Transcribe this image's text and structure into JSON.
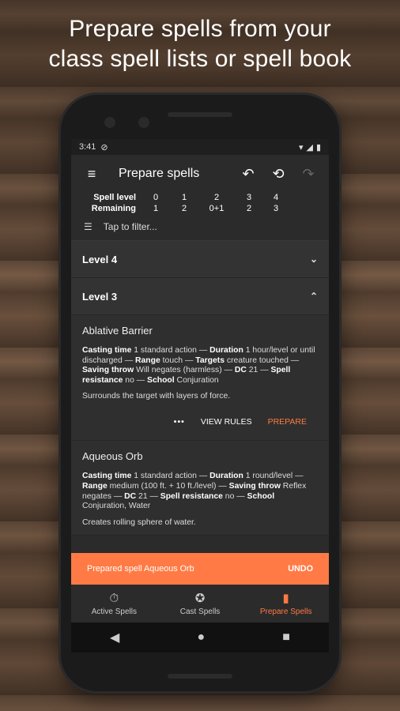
{
  "headline": {
    "line1": "Prepare spells from your",
    "line2": "class spell lists or spell book"
  },
  "status_bar": {
    "time": "3:41"
  },
  "appbar": {
    "title": "Prepare spells"
  },
  "slots": {
    "spell_level_label": "Spell level",
    "remaining_label": "Remaining",
    "levels": [
      "0",
      "1",
      "2",
      "3",
      "4"
    ],
    "remaining": [
      "1",
      "2",
      "0+1",
      "2",
      "3"
    ]
  },
  "filter": {
    "placeholder": "Tap to filter..."
  },
  "levels": {
    "level4": "Level 4",
    "level3": "Level 3"
  },
  "spells": [
    {
      "name": "Ablative Barrier",
      "description": [
        {
          "b": "Casting time",
          "t": " 1 standard action — "
        },
        {
          "b": "Duration",
          "t": " 1 hour/level or until discharged — "
        },
        {
          "b": "Range",
          "t": " touch — "
        },
        {
          "b": "Targets",
          "t": " creature touched — "
        },
        {
          "b": "Saving throw",
          "t": " Will negates (harmless) — "
        },
        {
          "b": "DC",
          "t": " 21 — "
        },
        {
          "b": "Spell resistance",
          "t": " no — "
        },
        {
          "b": "School",
          "t": " Conjuration"
        }
      ],
      "short": "Surrounds the target with layers of force.",
      "more_label": "•••",
      "view_rules_label": "VIEW RULES",
      "prepare_label": "PREPARE"
    },
    {
      "name": "Aqueous Orb",
      "description": [
        {
          "b": "Casting time",
          "t": " 1 standard action — "
        },
        {
          "b": "Duration",
          "t": " 1 round/level — "
        },
        {
          "b": "Range",
          "t": " medium (100 ft. + 10 ft./level) — "
        },
        {
          "b": "Saving throw",
          "t": " Reflex negates — "
        },
        {
          "b": "DC",
          "t": " 21 — "
        },
        {
          "b": "Spell resistance",
          "t": " no — "
        },
        {
          "b": "School",
          "t": " Conjuration, Water"
        }
      ],
      "short": "Creates rolling sphere of water."
    }
  ],
  "snackbar": {
    "message": "Prepared spell Aqueous Orb",
    "action": "UNDO"
  },
  "bottom_nav": [
    {
      "label": "Active Spells",
      "icon": "stopwatch-icon"
    },
    {
      "label": "Cast Spells",
      "icon": "star-circle-icon"
    },
    {
      "label": "Prepare Spells",
      "icon": "book-icon"
    }
  ],
  "colors": {
    "accent": "#ff7a45",
    "surface": "#2b2b2b",
    "card": "#2f2f2f"
  }
}
